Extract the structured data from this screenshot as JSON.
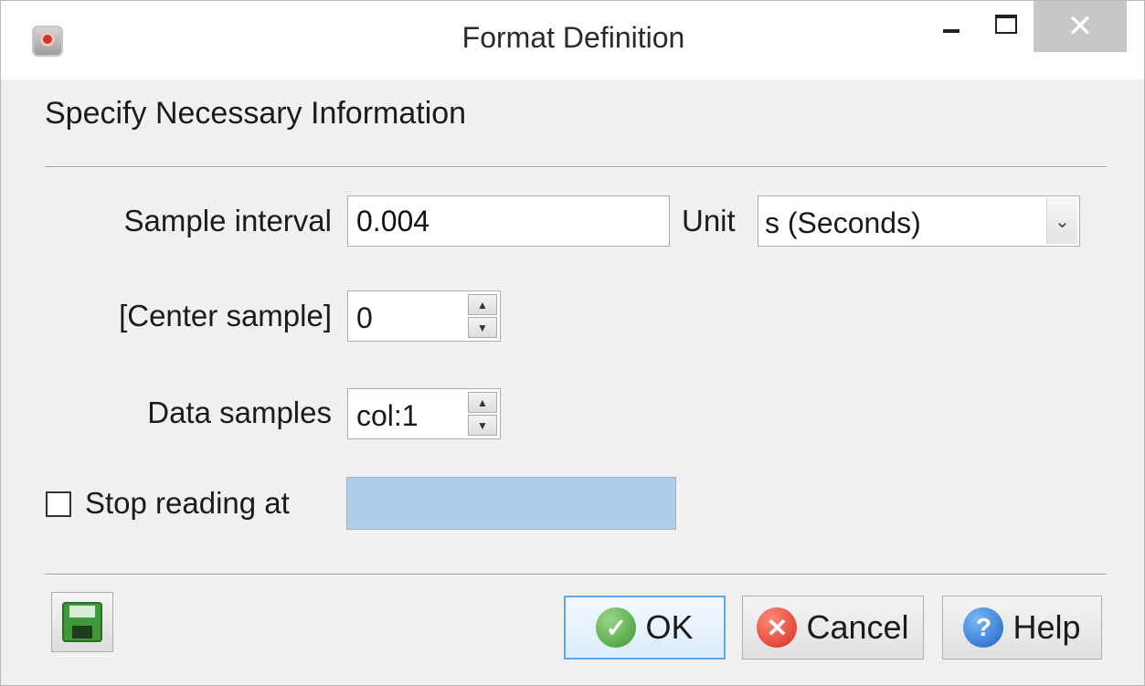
{
  "window": {
    "title": "Format Definition",
    "minimize_glyph": "",
    "close_glyph": "✕"
  },
  "heading": "Specify Necessary Information",
  "form": {
    "sample_interval_label": "Sample interval",
    "sample_interval_value": "0.004",
    "unit_label": "Unit",
    "unit_value": "s (Seconds)",
    "center_sample_label": "[Center sample]",
    "center_sample_value": "0",
    "data_samples_label": "Data samples",
    "data_samples_value": "col:1",
    "stop_reading_label": "Stop reading at",
    "stop_reading_checked": false,
    "stop_reading_value": ""
  },
  "buttons": {
    "ok": "OK",
    "cancel": "Cancel",
    "help": "Help"
  },
  "icons": {
    "ok": "check-icon",
    "cancel": "x-icon",
    "help": "question-icon",
    "save": "floppy-disk-icon"
  },
  "colors": {
    "ok_accent": "#5fa7e8",
    "disabled_field": "#b0cde9"
  }
}
